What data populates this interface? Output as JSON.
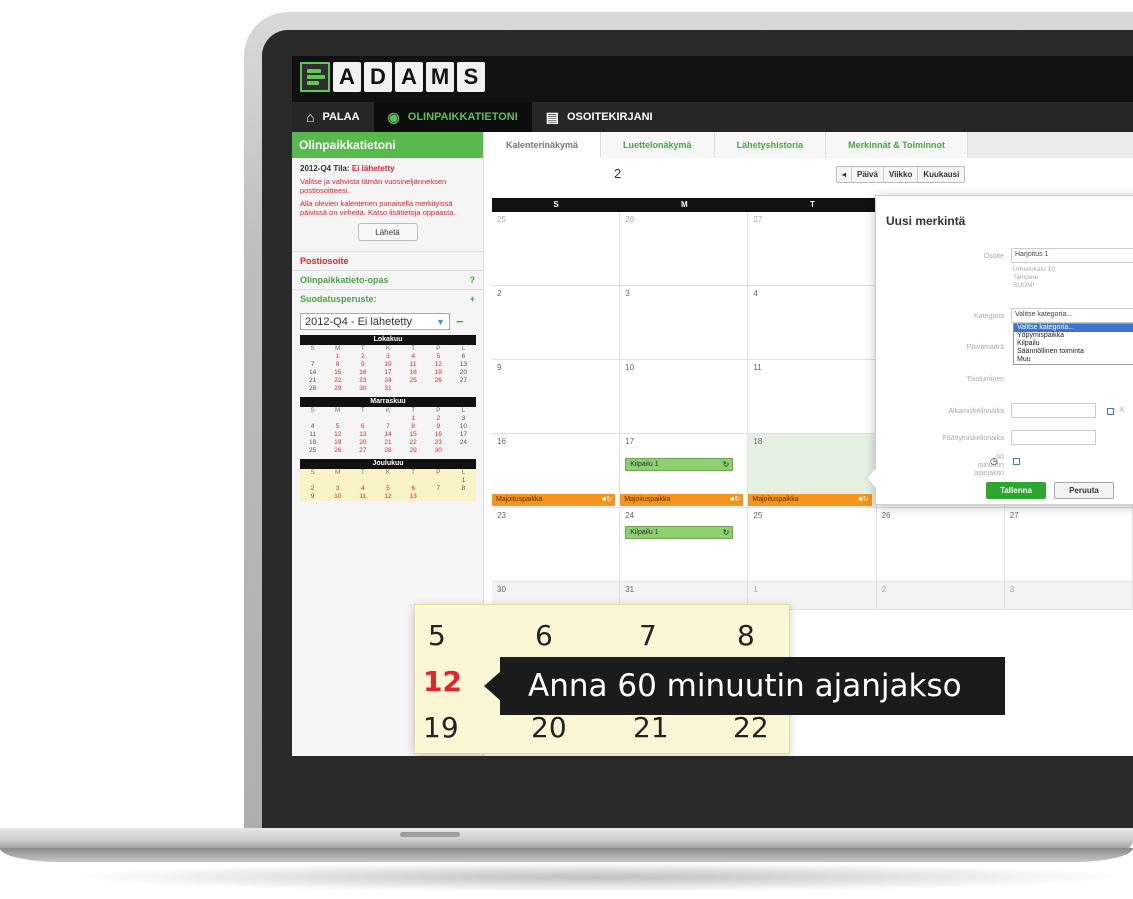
{
  "app": {
    "logo_letters": [
      "A",
      "D",
      "A",
      "M",
      "S"
    ],
    "accent_color": "#59b94e",
    "alert_color": "#e0252f"
  },
  "nav": {
    "items": [
      {
        "label": "PALAA",
        "icon": "home-icon"
      },
      {
        "label": "OLINPAIKKATIETONI",
        "icon": "location-pin-icon"
      },
      {
        "label": "OSOITEKIRJANI",
        "icon": "address-book-icon"
      }
    ]
  },
  "sidebar": {
    "title": "Olinpaikkatietoni",
    "period_label": "2012-Q4 Tila:",
    "period_status": "Ei lähetetty",
    "notes": [
      "Valitse ja vahvista tämän vuosineljänneksen postiosoitteesi.",
      "Alla olevien kalenterien punaisella merkityissä päivissä on virheitä. Katso lisätietoja oppaasta."
    ],
    "send_button": "Lähetä",
    "section_postal": "Postiosoite",
    "section_guide": "Olinpaikkatieto-opas",
    "guide_icon": "?",
    "section_filter": "Suodatusperuste:",
    "filter_icon": "+",
    "filter_value": "2012-Q4 - Ei lähetetty",
    "remove_icon": "−",
    "mini_calendars": [
      {
        "title": "Lokakuu",
        "weekdays": [
          "S",
          "M",
          "T",
          "K",
          "T",
          "P",
          "L"
        ],
        "days": [
          "",
          "1",
          "2",
          "3",
          "4",
          "5",
          "6",
          "7",
          "8",
          "9",
          "10",
          "11",
          "12",
          "13",
          "14",
          "15",
          "16",
          "17",
          "18",
          "19",
          "20",
          "21",
          "22",
          "23",
          "24",
          "25",
          "26",
          "27",
          "28",
          "29",
          "30",
          "31",
          "",
          "",
          ""
        ]
      },
      {
        "title": "Marraskuu",
        "weekdays": [
          "S",
          "M",
          "T",
          "K",
          "T",
          "P",
          "L"
        ],
        "days": [
          "",
          "",
          "",
          "",
          "1",
          "2",
          "3",
          "4",
          "5",
          "6",
          "7",
          "8",
          "9",
          "10",
          "11",
          "12",
          "13",
          "14",
          "15",
          "16",
          "17",
          "18",
          "19",
          "20",
          "21",
          "22",
          "23",
          "24",
          "25",
          "26",
          "27",
          "28",
          "29",
          "30",
          ""
        ]
      },
      {
        "title": "Joulukuu",
        "weekdays": [
          "S",
          "M",
          "T",
          "K",
          "T",
          "P",
          "L"
        ],
        "days": [
          "",
          "",
          "",
          "",
          "",
          "",
          "1",
          "2",
          "3",
          "4",
          "5",
          "6",
          "7",
          "8",
          "9",
          "10",
          "11",
          "12",
          "13",
          "",
          ""
        ]
      }
    ]
  },
  "tabs": [
    "Kalenterinäkymä",
    "Luettelonäkymä",
    "Lähetyshistoria",
    "Merkinnät & Toiminnot"
  ],
  "calendar": {
    "month_fragment": "2",
    "prev_icon": "◂",
    "views": [
      "Päivä",
      "Viikko",
      "Kuukausi"
    ],
    "weekday_headers": [
      "S",
      "M",
      "T",
      "",
      ""
    ],
    "rows": [
      [
        "25",
        "26",
        "27",
        "",
        ""
      ],
      [
        "2",
        "3",
        "4",
        "",
        ""
      ],
      [
        "9",
        "10",
        "11",
        "",
        ""
      ],
      [
        "16",
        "17",
        "18",
        "",
        ""
      ],
      [
        "23",
        "24",
        "25",
        "26",
        "27"
      ],
      [
        "30",
        "31",
        "1",
        "2",
        "3"
      ]
    ],
    "event_competition": "Kilpailu 1",
    "event_accommodation": "Majoituspaikka"
  },
  "popup": {
    "title": "Uusi merkintä",
    "label_address": "Osoite",
    "address_value": "Harjoitus 1",
    "address_lines": [
      "Urheilukatu 10",
      "Tampere",
      "SUOMI"
    ],
    "label_category": "Kategoria",
    "category_value": "Valitse kategoria...",
    "category_options": [
      "Valitse kategoria...",
      "Yöpymispaikka",
      "Kilpailu",
      "Säännöllinen toiminta",
      "Muu"
    ],
    "label_date": "Päivämäärä",
    "label_repeat": "Toistuminen",
    "label_start": "Alkamiskellonaika",
    "start_checkbox_label": "K",
    "label_end": "Päättymiskellonaika",
    "label_60min": "60 minuutin ajanjakso",
    "save": "Tallenna",
    "cancel": "Peruuta"
  },
  "zoom": {
    "rows": [
      [
        "5",
        "6",
        "7",
        "8"
      ],
      [
        "12",
        "",
        "",
        ""
      ],
      [
        "19",
        "20",
        "21",
        "22"
      ]
    ],
    "tooltip": "Anna 60 minuutin ajanjakso"
  }
}
